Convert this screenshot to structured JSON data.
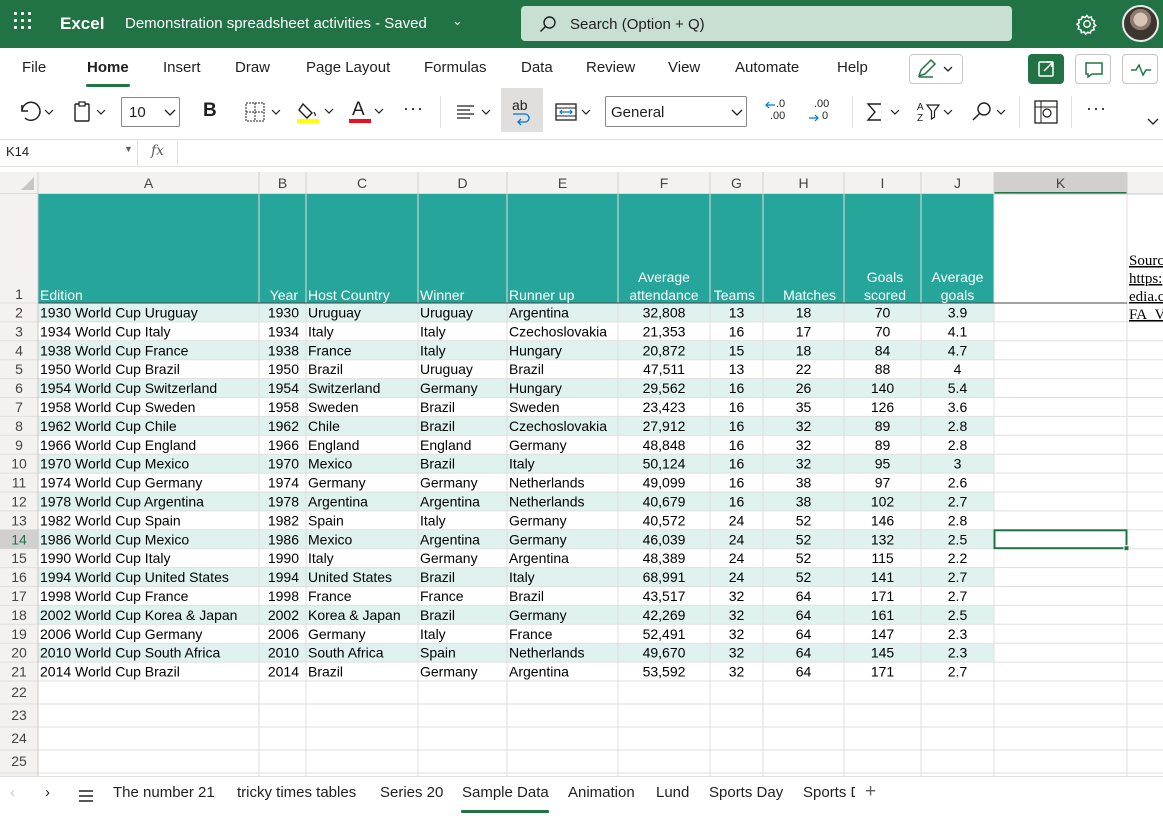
{
  "titlebar": {
    "app_name": "Excel",
    "doc_title": "Demonstration spreadsheet activities  -  Saved",
    "search_placeholder": "Search (Option + Q)",
    "colors": {
      "brand": "#217346",
      "search_bg": "#c8e0d2"
    }
  },
  "menu": {
    "items": [
      "File",
      "Home",
      "Insert",
      "Draw",
      "Page Layout",
      "Formulas",
      "Data",
      "Review",
      "View",
      "Automate",
      "Help"
    ],
    "active": "Home"
  },
  "ribbon": {
    "font_size": "10",
    "number_format": "General",
    "bold_label": "B",
    "font_color_label": "A",
    "wrap_label": "ab",
    "decimal_increase": [
      ".0",
      ".00"
    ],
    "decimal_decrease": [
      ".00",
      "0"
    ],
    "colors": {
      "fill": "#ffff00",
      "font": "#e81123"
    }
  },
  "formula_bar": {
    "name_box": "K14",
    "fx_label": "fx",
    "value": ""
  },
  "grid": {
    "columns": [
      "A",
      "B",
      "C",
      "D",
      "E",
      "F",
      "G",
      "H",
      "I",
      "J",
      "K"
    ],
    "selected_column": "K",
    "selected_row": "14",
    "header_fill": "#26a69a",
    "band_fill": "#dff2f0",
    "headers": [
      "Edition",
      "Year",
      "Host Country",
      "Winner",
      "Runner up",
      "Average attendance",
      "Teams",
      "Matches",
      "Goals scored",
      "Average goals"
    ],
    "rows": [
      [
        "1930 World Cup Uruguay",
        "1930",
        "Uruguay",
        "Uruguay",
        "Argentina",
        "32,808",
        "13",
        "18",
        "70",
        "3.9"
      ],
      [
        "1934 World Cup Italy",
        "1934",
        "Italy",
        "Italy",
        "Czechoslovakia",
        "21,353",
        "16",
        "17",
        "70",
        "4.1"
      ],
      [
        "1938 World Cup France",
        "1938",
        "France",
        "Italy",
        "Hungary",
        "20,872",
        "15",
        "18",
        "84",
        "4.7"
      ],
      [
        "1950 World Cup Brazil",
        "1950",
        "Brazil",
        "Uruguay",
        "Brazil",
        "47,511",
        "13",
        "22",
        "88",
        "4"
      ],
      [
        "1954 World Cup Switzerland",
        "1954",
        "Switzerland",
        "Germany",
        "Hungary",
        "29,562",
        "16",
        "26",
        "140",
        "5.4"
      ],
      [
        "1958 World Cup Sweden",
        "1958",
        "Sweden",
        "Brazil",
        "Sweden",
        "23,423",
        "16",
        "35",
        "126",
        "3.6"
      ],
      [
        "1962 World Cup Chile",
        "1962",
        "Chile",
        "Brazil",
        "Czechoslovakia",
        "27,912",
        "16",
        "32",
        "89",
        "2.8"
      ],
      [
        "1966 World Cup England",
        "1966",
        "England",
        "England",
        "Germany",
        "48,848",
        "16",
        "32",
        "89",
        "2.8"
      ],
      [
        "1970 World Cup Mexico",
        "1970",
        "Mexico",
        "Brazil",
        "Italy",
        "50,124",
        "16",
        "32",
        "95",
        "3"
      ],
      [
        "1974 World Cup Germany",
        "1974",
        "Germany",
        "Germany",
        "Netherlands",
        "49,099",
        "16",
        "38",
        "97",
        "2.6"
      ],
      [
        "1978 World Cup Argentina",
        "1978",
        "Argentina",
        "Argentina",
        "Netherlands",
        "40,679",
        "16",
        "38",
        "102",
        "2.7"
      ],
      [
        "1982 World Cup Spain",
        "1982",
        "Spain",
        "Italy",
        "Germany",
        "40,572",
        "24",
        "52",
        "146",
        "2.8"
      ],
      [
        "1986 World Cup Mexico",
        "1986",
        "Mexico",
        "Argentina",
        "Germany",
        "46,039",
        "24",
        "52",
        "132",
        "2.5"
      ],
      [
        "1990 World Cup Italy",
        "1990",
        "Italy",
        "Germany",
        "Argentina",
        "48,389",
        "24",
        "52",
        "115",
        "2.2"
      ],
      [
        "1994 World Cup United States",
        "1994",
        "United States",
        "Brazil",
        "Italy",
        "68,991",
        "24",
        "52",
        "141",
        "2.7"
      ],
      [
        "1998 World Cup France",
        "1998",
        "France",
        "France",
        "Brazil",
        "43,517",
        "32",
        "64",
        "171",
        "2.7"
      ],
      [
        "2002 World Cup Korea & Japan",
        "2002",
        "Korea & Japan",
        "Brazil",
        "Germany",
        "42,269",
        "32",
        "64",
        "161",
        "2.5"
      ],
      [
        "2006 World Cup Germany",
        "2006",
        "Germany",
        "Italy",
        "France",
        "52,491",
        "32",
        "64",
        "147",
        "2.3"
      ],
      [
        "2010 World Cup South Africa",
        "2010",
        "South Africa",
        "Spain",
        "Netherlands",
        "49,670",
        "32",
        "64",
        "145",
        "2.3"
      ],
      [
        "2014 World Cup Brazil",
        "2014",
        "Brazil",
        "Germany",
        "Argentina",
        "53,592",
        "32",
        "64",
        "171",
        "2.7"
      ]
    ],
    "source_fragments": [
      "Sourc",
      "https:",
      "edia.c",
      "FA_V"
    ],
    "row_numbers": [
      "1",
      "2",
      "3",
      "4",
      "5",
      "6",
      "7",
      "8",
      "9",
      "10",
      "11",
      "12",
      "13",
      "14",
      "15",
      "16",
      "17",
      "18",
      "19",
      "20",
      "21",
      "22",
      "23",
      "24",
      "25"
    ]
  },
  "sheet_tabs": {
    "tabs": [
      "The number 21",
      "tricky times tables",
      "Series 20",
      "Sample Data",
      "Animation",
      "Lund",
      "Sports Day",
      "Sports D"
    ],
    "active": "Sample Data",
    "add_label": "+"
  }
}
